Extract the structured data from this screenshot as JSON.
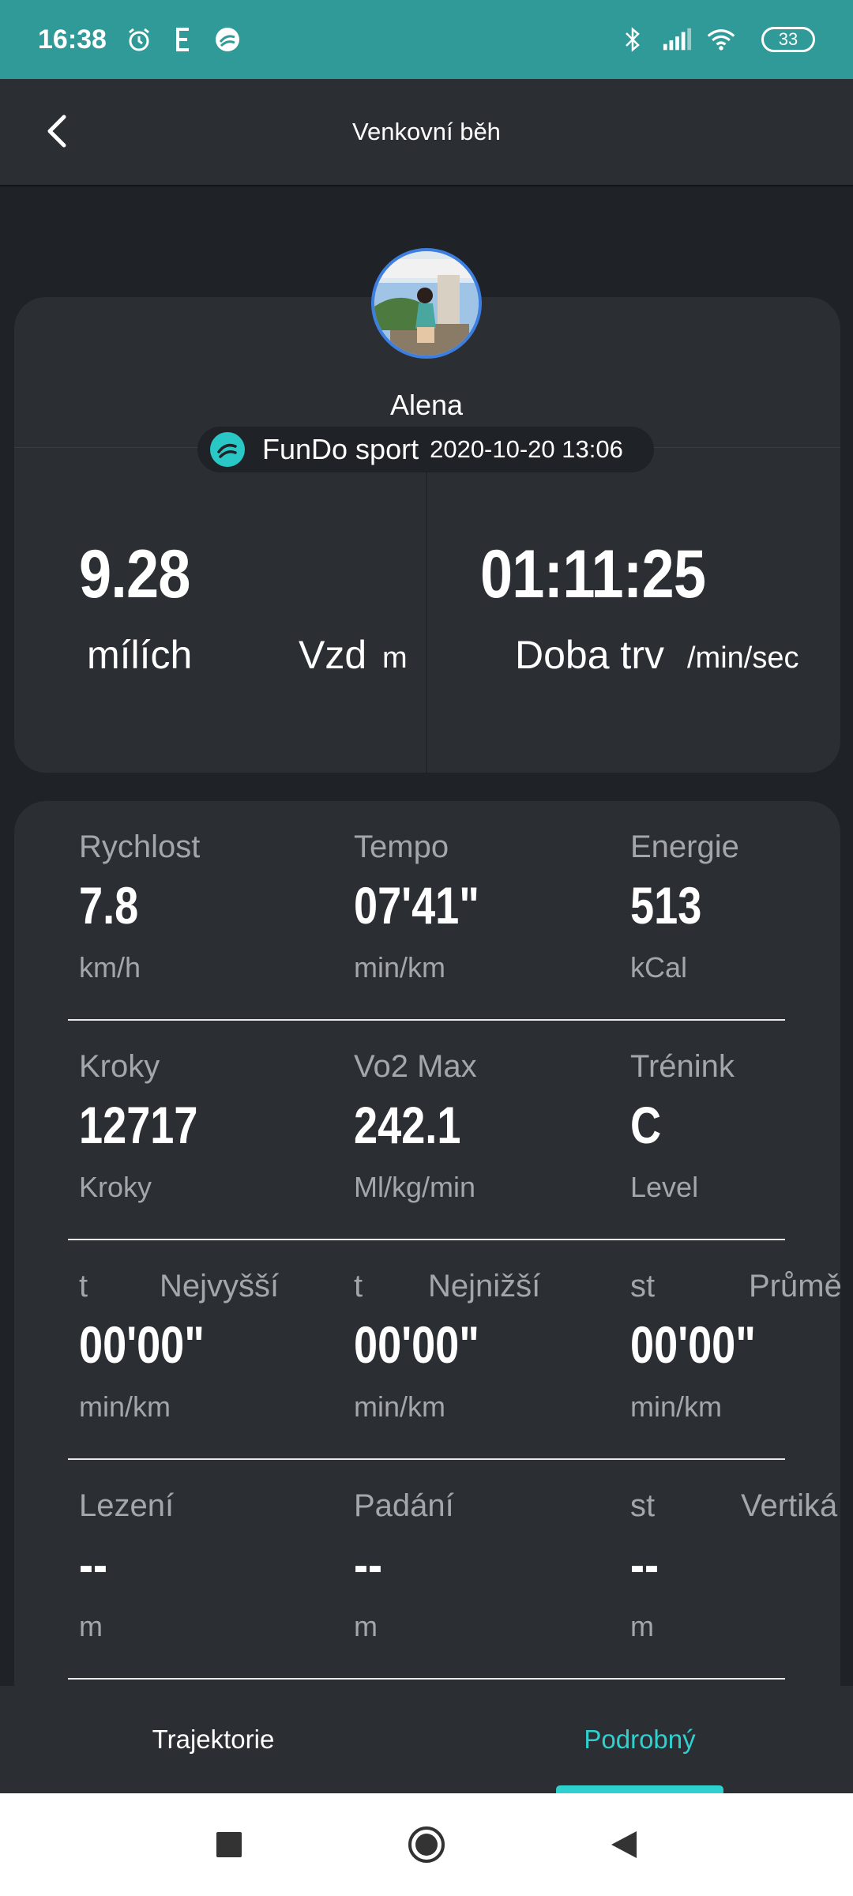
{
  "status_bar": {
    "time": "16:38",
    "battery": "33",
    "icons": [
      "alarm-icon",
      "e-icon",
      "fundo-icon",
      "bluetooth-icon",
      "signal-icon",
      "wifi-icon",
      "battery-icon"
    ]
  },
  "header": {
    "title": "Venkovní běh",
    "back_icon": "chevron-left-icon"
  },
  "profile": {
    "name": "Alena",
    "app_name": "FunDo sport",
    "date": "2020-10-20 13:06"
  },
  "summary": {
    "distance_value": "9.28",
    "distance_unit": "mílích",
    "distance_label": "Vzd",
    "distance_label_suffix": "m",
    "duration_value": "01:11:25",
    "duration_label": "Doba trv",
    "duration_unit": "/min/sec"
  },
  "stats": {
    "row1": [
      {
        "label": "Rychlost",
        "value": "7.8",
        "unit": "km/h"
      },
      {
        "label": "Tempo",
        "value": "07'41\"",
        "unit": "min/km"
      },
      {
        "label": "Energie",
        "value": "513",
        "unit": "kCal"
      }
    ],
    "row2": [
      {
        "label": "Kroky",
        "value": "12717",
        "unit": "Kroky"
      },
      {
        "label": "Vo2 Max",
        "value": "242.1",
        "unit": "Ml/kg/min"
      },
      {
        "label": "Trénink",
        "value": "C",
        "unit": "Level"
      }
    ],
    "row3": [
      {
        "label_prefix": "t",
        "label": "Nejvyšší",
        "value": "00'00\"",
        "unit": "min/km"
      },
      {
        "label_prefix": "t",
        "label": "Nejnižší",
        "value": "00'00\"",
        "unit": "min/km"
      },
      {
        "label_prefix": "st",
        "label": "Průměr",
        "value": "00'00\"",
        "unit": "min/km"
      }
    ],
    "row4": [
      {
        "label": "Lezení",
        "value": "--",
        "unit": "m"
      },
      {
        "label": "Padání",
        "value": "--",
        "unit": "m"
      },
      {
        "label_prefix": "st",
        "label": "Vertiká",
        "value": "--",
        "unit": "m"
      }
    ]
  },
  "tabs": {
    "trajectory": "Trajektorie",
    "detail": "Podrobný"
  },
  "colors": {
    "status_bar": "#2f9a97",
    "accent": "#2fd1cf",
    "background": "#1f2226",
    "card": "#2b2e33"
  }
}
